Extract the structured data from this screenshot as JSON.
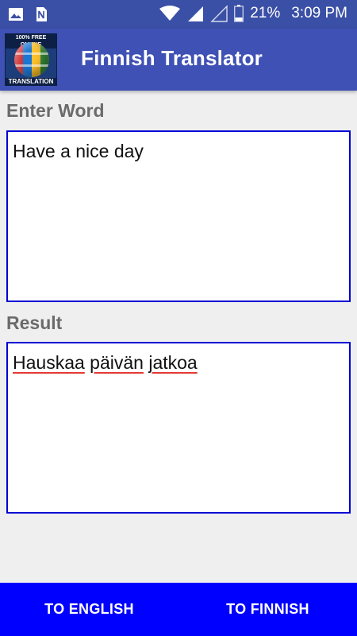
{
  "status_bar": {
    "battery": "21%",
    "time": "3:09 PM",
    "icons": [
      "image-icon",
      "sim-icon",
      "wifi-icon",
      "signal-icon",
      "signal-empty-icon",
      "battery-icon"
    ]
  },
  "app_bar": {
    "title": "Finnish Translator",
    "logo_top_text": "100% FREE ONLINE",
    "logo_bottom_text": "TRANSLATION"
  },
  "input": {
    "label": "Enter Word",
    "value": "Have a nice day"
  },
  "result": {
    "label": "Result",
    "words": [
      "Hauskaa",
      "päivän",
      "jatkoa"
    ]
  },
  "buttons": {
    "to_english": "TO ENGLISH",
    "to_finnish": "TO FINNISH"
  },
  "colors": {
    "status_bar": "#3a4fa6",
    "app_bar": "#3f51b5",
    "box_border": "#0000d6",
    "bottom_bar": "#0000ff",
    "spell_underline": "#e53935"
  }
}
